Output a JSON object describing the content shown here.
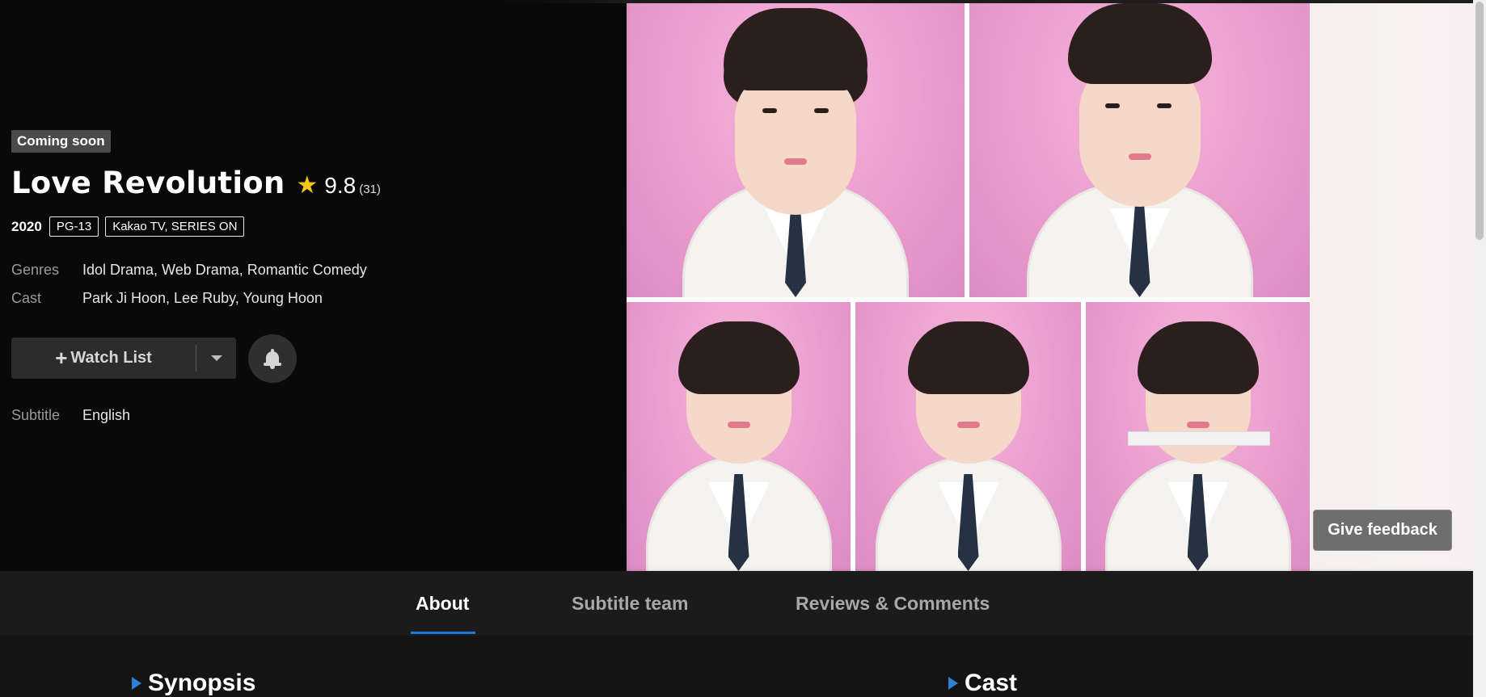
{
  "show": {
    "status_badge": "Coming soon",
    "title": "Love Revolution",
    "rating": "9.8",
    "rating_count": "(31)",
    "year": "2020",
    "content_rating": "PG-13",
    "network": "Kakao TV, SERIES ON"
  },
  "details": {
    "genres_label": "Genres",
    "genres_value": "Idol Drama, Web Drama, Romantic Comedy",
    "cast_label": "Cast",
    "cast_value": "Park Ji Hoon, Lee Ruby, Young Hoon",
    "subtitle_label": "Subtitle",
    "subtitle_value": "English"
  },
  "actions": {
    "watch_list_label": "Watch List",
    "plus_icon": "+",
    "dropdown_icon": "caret-down-icon",
    "notify_icon": "bell-icon",
    "feedback_label": "Give feedback"
  },
  "tabs": [
    {
      "label": "About",
      "active": true
    },
    {
      "label": "Subtitle team",
      "active": false
    },
    {
      "label": "Reviews & Comments",
      "active": false
    }
  ],
  "sections": {
    "synopsis": "Synopsis",
    "cast": "Cast"
  },
  "colors": {
    "accent_blue": "#1a78d8",
    "star_yellow": "#f5c518",
    "background": "#090909"
  }
}
